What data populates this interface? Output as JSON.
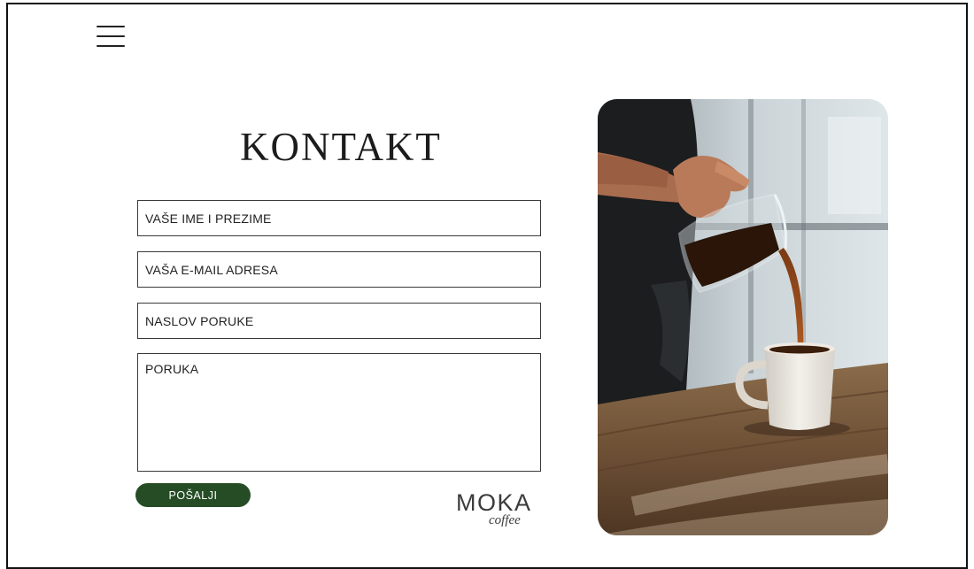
{
  "header": {
    "menu_icon": "hamburger-menu-icon"
  },
  "contact": {
    "title": "KONTAKT",
    "fields": {
      "name_placeholder": "VAŠE IME I PREZIME",
      "email_placeholder": "VAŠA E-MAIL ADRESA",
      "subject_placeholder": "NASLOV PORUKE",
      "message_placeholder": "PORUKA"
    },
    "submit_label": "POŠALJI"
  },
  "logo": {
    "main": "MOKA",
    "sub": "coffee"
  },
  "image": {
    "subject": "coffee-pour-photo"
  },
  "colors": {
    "button_bg": "#254c25",
    "button_text": "#ffffff",
    "text": "#222222",
    "border": "#3a3a3a"
  }
}
